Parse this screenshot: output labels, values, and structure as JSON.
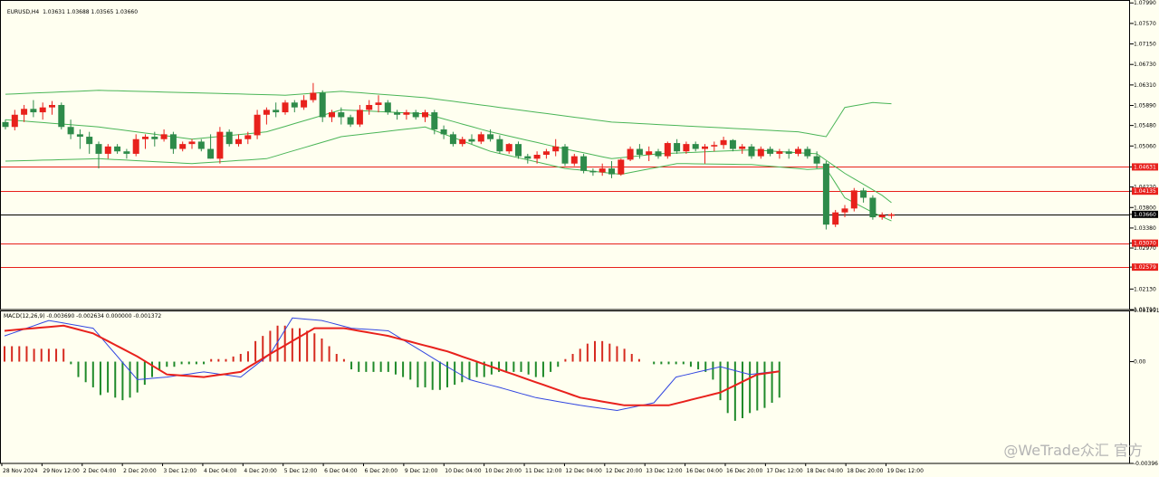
{
  "header": {
    "symbol": "EURUSD,H4",
    "ohlc": "1.03631 1.03688 1.03565 1.03660"
  },
  "macd": {
    "label": "MACD(12,26,9) -0.003690 -0.002634 0.000000 -0.001372"
  },
  "watermark": "@WeTrade众汇 官方",
  "colors": {
    "background": "#fffff0",
    "bull": "#e8211c",
    "bear": "#2e8b4a",
    "bands": "#4ab557",
    "level_line": "#e8211c",
    "price_line": "#000000",
    "macd_line": "#e8211c",
    "signal_line": "#3347e0",
    "hist_pos": "#d62a1f",
    "hist_neg": "#1f8a2a"
  },
  "chart_data": {
    "type": "candlestick",
    "symbol": "EURUSD",
    "timeframe": "H4",
    "ylim": [
      1.0171,
      1.0805
    ],
    "y_ticks": [
      "1.07990",
      "1.07570",
      "1.07150",
      "1.06730",
      "1.06310",
      "1.05890",
      "1.05480",
      "1.05060",
      "1.04631",
      "1.04220",
      "1.04135",
      "1.03800",
      "1.03660",
      "1.03380",
      "1.03070",
      "1.02970",
      "1.02579",
      "1.02130",
      "1.01710"
    ],
    "x_ticks": [
      "28 Nov 2024",
      "29 Nov 12:00",
      "2 Dec 04:00",
      "2 Dec 20:00",
      "3 Dec 12:00",
      "4 Dec 04:00",
      "4 Dec 20:00",
      "5 Dec 12:00",
      "6 Dec 04:00",
      "6 Dec 20:00",
      "9 Dec 12:00",
      "10 Dec 04:00",
      "10 Dec 20:00",
      "11 Dec 12:00",
      "12 Dec 04:00",
      "12 Dec 20:00",
      "13 Dec 12:00",
      "16 Dec 04:00",
      "16 Dec 20:00",
      "17 Dec 12:00",
      "18 Dec 04:00",
      "18 Dec 20:00",
      "19 Dec 12:00"
    ],
    "levels": [
      {
        "price": 1.04631,
        "label": "1.04631"
      },
      {
        "price": 1.04135,
        "label": "1.04135"
      },
      {
        "price": 1.0307,
        "label": "1.03070"
      },
      {
        "price": 1.02579,
        "label": "1.02579"
      }
    ],
    "current_price": {
      "price": 1.0366,
      "label": "1.03660"
    },
    "candles": [
      [
        1.0555,
        1.056,
        1.054,
        1.0545
      ],
      [
        1.0545,
        1.058,
        1.0538,
        1.057
      ],
      [
        1.057,
        1.059,
        1.0555,
        1.0582
      ],
      [
        1.0582,
        1.06,
        1.0565,
        1.0575
      ],
      [
        1.0575,
        1.0595,
        1.056,
        1.0585
      ],
      [
        1.0585,
        1.0598,
        1.057,
        1.059
      ],
      [
        1.059,
        1.0595,
        1.054,
        1.0545
      ],
      [
        1.0545,
        1.056,
        1.052,
        1.053
      ],
      [
        1.053,
        1.054,
        1.05,
        1.0525
      ],
      [
        1.0525,
        1.0535,
        1.049,
        1.051
      ],
      [
        1.051,
        1.0515,
        1.046,
        1.049
      ],
      [
        1.049,
        1.051,
        1.048,
        1.0505
      ],
      [
        1.0505,
        1.051,
        1.049,
        1.0495
      ],
      [
        1.0495,
        1.05,
        1.048,
        1.049
      ],
      [
        1.049,
        1.053,
        1.0485,
        1.052
      ],
      [
        1.052,
        1.053,
        1.05,
        1.0525
      ],
      [
        1.0525,
        1.0535,
        1.0505,
        1.052
      ],
      [
        1.052,
        1.054,
        1.0515,
        1.053
      ],
      [
        1.053,
        1.0535,
        1.049,
        1.05
      ],
      [
        1.05,
        1.0515,
        1.0495,
        1.051
      ],
      [
        1.051,
        1.052,
        1.05,
        1.0515
      ],
      [
        1.0515,
        1.052,
        1.0495,
        1.05
      ],
      [
        1.05,
        1.053,
        1.048,
        1.048
      ],
      [
        1.048,
        1.0545,
        1.047,
        1.0535
      ],
      [
        1.0535,
        1.054,
        1.0505,
        1.051
      ],
      [
        1.051,
        1.053,
        1.0505,
        1.052
      ],
      [
        1.052,
        1.0535,
        1.051,
        1.0528
      ],
      [
        1.0528,
        1.058,
        1.052,
        1.057
      ],
      [
        1.057,
        1.0585,
        1.055,
        1.058
      ],
      [
        1.058,
        1.0595,
        1.0565,
        1.0575
      ],
      [
        1.0575,
        1.06,
        1.057,
        1.0595
      ],
      [
        1.0595,
        1.06,
        1.0575,
        1.0585
      ],
      [
        1.0585,
        1.061,
        1.058,
        1.06
      ],
      [
        1.06,
        1.0635,
        1.0595,
        1.0615
      ],
      [
        1.0615,
        1.062,
        1.0555,
        1.0565
      ],
      [
        1.0565,
        1.058,
        1.0555,
        1.0575
      ],
      [
        1.0575,
        1.0585,
        1.055,
        1.0565
      ],
      [
        1.0565,
        1.057,
        1.0545,
        1.055
      ],
      [
        1.055,
        1.059,
        1.0545,
        1.058
      ],
      [
        1.058,
        1.06,
        1.057,
        1.059
      ],
      [
        1.059,
        1.061,
        1.0575,
        1.0595
      ],
      [
        1.0595,
        1.06,
        1.057,
        1.0575
      ],
      [
        1.0575,
        1.058,
        1.056,
        1.057
      ],
      [
        1.057,
        1.058,
        1.056,
        1.0575
      ],
      [
        1.0575,
        1.058,
        1.056,
        1.0565
      ],
      [
        1.0565,
        1.058,
        1.0555,
        1.0575
      ],
      [
        1.0575,
        1.058,
        1.053,
        1.054
      ],
      [
        1.054,
        1.0548,
        1.052,
        1.053
      ],
      [
        1.053,
        1.0535,
        1.0505,
        1.051
      ],
      [
        1.051,
        1.0525,
        1.0505,
        1.052
      ],
      [
        1.052,
        1.053,
        1.051,
        1.0515
      ],
      [
        1.0515,
        1.0535,
        1.051,
        1.053
      ],
      [
        1.053,
        1.054,
        1.0515,
        1.052
      ],
      [
        1.052,
        1.0528,
        1.049,
        1.0495
      ],
      [
        1.0495,
        1.0512,
        1.049,
        1.051
      ],
      [
        1.051,
        1.0515,
        1.048,
        1.0485
      ],
      [
        1.0485,
        1.049,
        1.047,
        1.048
      ],
      [
        1.048,
        1.0495,
        1.047,
        1.0488
      ],
      [
        1.0488,
        1.05,
        1.048,
        1.0495
      ],
      [
        1.0495,
        1.052,
        1.0485,
        1.0505
      ],
      [
        1.0505,
        1.051,
        1.0465,
        1.047
      ],
      [
        1.047,
        1.049,
        1.0465,
        1.0485
      ],
      [
        1.0485,
        1.049,
        1.045,
        1.0455
      ],
      [
        1.0455,
        1.046,
        1.0445,
        1.0452
      ],
      [
        1.0452,
        1.047,
        1.0445,
        1.046
      ],
      [
        1.046,
        1.0475,
        1.044,
        1.0448
      ],
      [
        1.0448,
        1.048,
        1.0445,
        1.0478
      ],
      [
        1.0478,
        1.0505,
        1.0475,
        1.05
      ],
      [
        1.05,
        1.051,
        1.048,
        1.0488
      ],
      [
        1.0488,
        1.0505,
        1.0475,
        1.0495
      ],
      [
        1.0495,
        1.05,
        1.048,
        1.0485
      ],
      [
        1.0485,
        1.0515,
        1.048,
        1.0512
      ],
      [
        1.0512,
        1.052,
        1.049,
        1.0495
      ],
      [
        1.0495,
        1.0515,
        1.049,
        1.051
      ],
      [
        1.051,
        1.0515,
        1.0495,
        1.05
      ],
      [
        1.05,
        1.051,
        1.047,
        1.0505
      ],
      [
        1.0505,
        1.0515,
        1.0495,
        1.0508
      ],
      [
        1.0508,
        1.0525,
        1.05,
        1.0518
      ],
      [
        1.0518,
        1.052,
        1.0495,
        1.05
      ],
      [
        1.05,
        1.051,
        1.049,
        1.0505
      ],
      [
        1.0505,
        1.051,
        1.048,
        1.0485
      ],
      [
        1.0485,
        1.0505,
        1.048,
        1.05
      ],
      [
        1.05,
        1.0505,
        1.0485,
        1.049
      ],
      [
        1.049,
        1.05,
        1.048,
        1.0495
      ],
      [
        1.0495,
        1.05,
        1.048,
        1.049
      ],
      [
        1.049,
        1.0505,
        1.0485,
        1.05
      ],
      [
        1.05,
        1.0505,
        1.048,
        1.0485
      ],
      [
        1.0485,
        1.0495,
        1.046,
        1.047
      ],
      [
        1.047,
        1.0475,
        1.0335,
        1.0345
      ],
      [
        1.0345,
        1.0375,
        1.034,
        1.037
      ],
      [
        1.037,
        1.0385,
        1.036,
        1.0378
      ],
      [
        1.0378,
        1.042,
        1.0372,
        1.0415
      ],
      [
        1.0415,
        1.042,
        1.039,
        1.04
      ],
      [
        1.04,
        1.0405,
        1.0355,
        1.036
      ],
      [
        1.036,
        1.037,
        1.0355,
        1.0365
      ],
      [
        1.0363,
        1.0369,
        1.0357,
        1.0366
      ]
    ],
    "bands": {
      "upper_anchor": [
        [
          0,
          1.0612
        ],
        [
          10,
          1.062
        ],
        [
          20,
          1.0615
        ],
        [
          30,
          1.061
        ],
        [
          36,
          1.0618
        ],
        [
          45,
          1.0605
        ],
        [
          55,
          1.058
        ],
        [
          65,
          1.0555
        ],
        [
          75,
          1.0545
        ],
        [
          85,
          1.0535
        ],
        [
          88,
          1.0525
        ],
        [
          90,
          1.0585
        ],
        [
          93,
          1.0595
        ],
        [
          97,
          1.059
        ]
      ],
      "middle_anchor": [
        [
          0,
          1.056
        ],
        [
          10,
          1.0545
        ],
        [
          20,
          1.052
        ],
        [
          28,
          1.0535
        ],
        [
          36,
          1.058
        ],
        [
          45,
          1.0572
        ],
        [
          52,
          1.0535
        ],
        [
          60,
          1.05
        ],
        [
          65,
          1.048
        ],
        [
          70,
          1.049
        ],
        [
          80,
          1.0498
        ],
        [
          87,
          1.049
        ],
        [
          90,
          1.045
        ],
        [
          94,
          1.0405
        ],
        [
          97,
          1.036
        ]
      ],
      "lower_anchor": [
        [
          0,
          1.0475
        ],
        [
          10,
          1.048
        ],
        [
          20,
          1.047
        ],
        [
          28,
          1.048
        ],
        [
          36,
          1.0525
        ],
        [
          45,
          1.0545
        ],
        [
          52,
          1.0495
        ],
        [
          60,
          1.046
        ],
        [
          66,
          1.0448
        ],
        [
          72,
          1.047
        ],
        [
          80,
          1.0468
        ],
        [
          86,
          1.0458
        ],
        [
          88,
          1.046
        ],
        [
          90,
          1.04
        ],
        [
          93,
          1.037
        ],
        [
          97,
          1.0335
        ]
      ]
    },
    "macd": {
      "ylim": [
        -0.00396,
        0.001991
      ],
      "y_ticks": [
        "0.001991",
        "0.00",
        "-0.00396"
      ],
      "histogram": [
        0.0006,
        0.0006,
        0.0006,
        0.0006,
        0.0005,
        0.0005,
        0.0005,
        0.0005,
        0.0005,
        -0.0001,
        -0.0006,
        -0.0008,
        -0.001,
        -0.0013,
        -0.0012,
        -0.0014,
        -0.0015,
        -0.0014,
        -0.0012,
        -0.0009,
        -0.0006,
        -0.0003,
        -0.0002,
        -0.0002,
        -0.0001,
        -0.0001,
        -0.0001,
        -0.0001,
        0.0001,
        0.0001,
        0.0001,
        0.0002,
        0.0003,
        0.0004,
        0.0008,
        0.001,
        0.0012,
        0.0014,
        0.0014,
        0.0013,
        0.0013,
        0.0012,
        0.0011,
        0.0009,
        0.0006,
        0.0003,
        0.0001,
        -0.0003,
        -0.0004,
        -0.0004,
        -0.0004,
        -0.0004,
        -0.0004,
        -0.0005,
        -0.0006,
        -0.0007,
        -0.001,
        -0.001,
        -0.0011,
        -0.0011,
        -0.001,
        -0.0009,
        -0.0008,
        -0.0007,
        -0.0006,
        -0.0006,
        -0.0005,
        -0.0004,
        -0.0004,
        -0.0004,
        -0.0004,
        -0.0005,
        -0.0006,
        -0.0006,
        -0.0004,
        -0.0002,
        0.0001,
        0.0003,
        0.0005,
        0.0007,
        0.0008,
        0.0008,
        0.0007,
        0.0006,
        0.0005,
        0.0003,
        0.0001,
        0.0,
        -0.0001,
        -0.0001,
        -0.0001,
        -0.0001,
        -0.0001,
        -0.0002,
        -0.0003,
        -0.0004,
        -0.0007,
        -0.0015,
        -0.002,
        -0.0023,
        -0.0022,
        -0.002,
        -0.0019,
        -0.0018,
        -0.0016,
        -0.0014
      ],
      "main_anchor": [
        [
          0,
          0.0012
        ],
        [
          8,
          0.0014
        ],
        [
          12,
          0.0011
        ],
        [
          18,
          0.0002
        ],
        [
          22,
          -0.0005
        ],
        [
          27,
          -0.0006
        ],
        [
          32,
          -0.0004
        ],
        [
          36,
          0.0003
        ],
        [
          42,
          0.0013
        ],
        [
          46,
          0.0013
        ],
        [
          52,
          0.001
        ],
        [
          60,
          0.0004
        ],
        [
          65,
          -0.0001
        ],
        [
          70,
          -0.0006
        ],
        [
          78,
          -0.0014
        ],
        [
          84,
          -0.0017
        ],
        [
          90,
          -0.0017
        ],
        [
          97,
          -0.0012
        ],
        [
          102,
          -0.0005
        ],
        [
          107,
          -0.0003
        ],
        [
          113,
          -0.0004
        ],
        [
          117,
          -0.0012
        ],
        [
          120,
          -0.0026
        ]
      ],
      "signal_anchor": [
        [
          0,
          0.001
        ],
        [
          6,
          0.0016
        ],
        [
          12,
          0.0013
        ],
        [
          18,
          -0.0007
        ],
        [
          22,
          -0.0006
        ],
        [
          27,
          -0.0004
        ],
        [
          32,
          -0.0006
        ],
        [
          36,
          0.0003
        ],
        [
          39,
          0.0017
        ],
        [
          43,
          0.0016
        ],
        [
          47,
          0.0013
        ],
        [
          52,
          0.0012
        ],
        [
          60,
          -0.0002
        ],
        [
          63,
          -0.0007
        ],
        [
          67,
          -0.001
        ],
        [
          72,
          -0.0014
        ],
        [
          78,
          -0.0017
        ],
        [
          83,
          -0.0019
        ],
        [
          88,
          -0.0016
        ],
        [
          91,
          -0.0006
        ],
        [
          97,
          -0.0002
        ],
        [
          101,
          -0.0005
        ],
        [
          107,
          -0.0003
        ],
        [
          113,
          -0.0006
        ],
        [
          116,
          -0.003
        ],
        [
          120,
          -0.0037
        ]
      ]
    }
  }
}
